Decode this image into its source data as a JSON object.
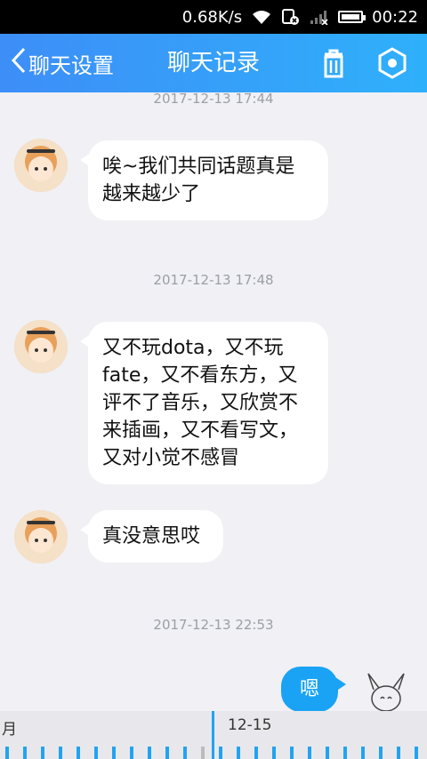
{
  "status": {
    "speed": "0.68K/s",
    "time": "00:22"
  },
  "header": {
    "back_label": "聊天设置",
    "title": "聊天记录"
  },
  "messages": [
    {
      "time": "2017-12-13 17:44",
      "text": "唉~我们共同话题真是越来越少了",
      "side": "left"
    },
    {
      "time": "2017-12-13 17:48",
      "text": "又不玩dota，又不玩fate，又不看东方，又评不了音乐，又欣赏不来插画，又不看写文，又对小觉不感冒",
      "side": "left"
    },
    {
      "time": "",
      "text": "真没意思哎",
      "side": "left"
    },
    {
      "time": "2017-12-13 22:53",
      "text": "嗯",
      "side": "right"
    }
  ],
  "timeline": {
    "left_label": "月",
    "date_label": "12-15"
  },
  "colors": {
    "header_start": "#3d8ef7",
    "header_end": "#2fb0fb",
    "my_bubble": "#1aa3f5"
  }
}
